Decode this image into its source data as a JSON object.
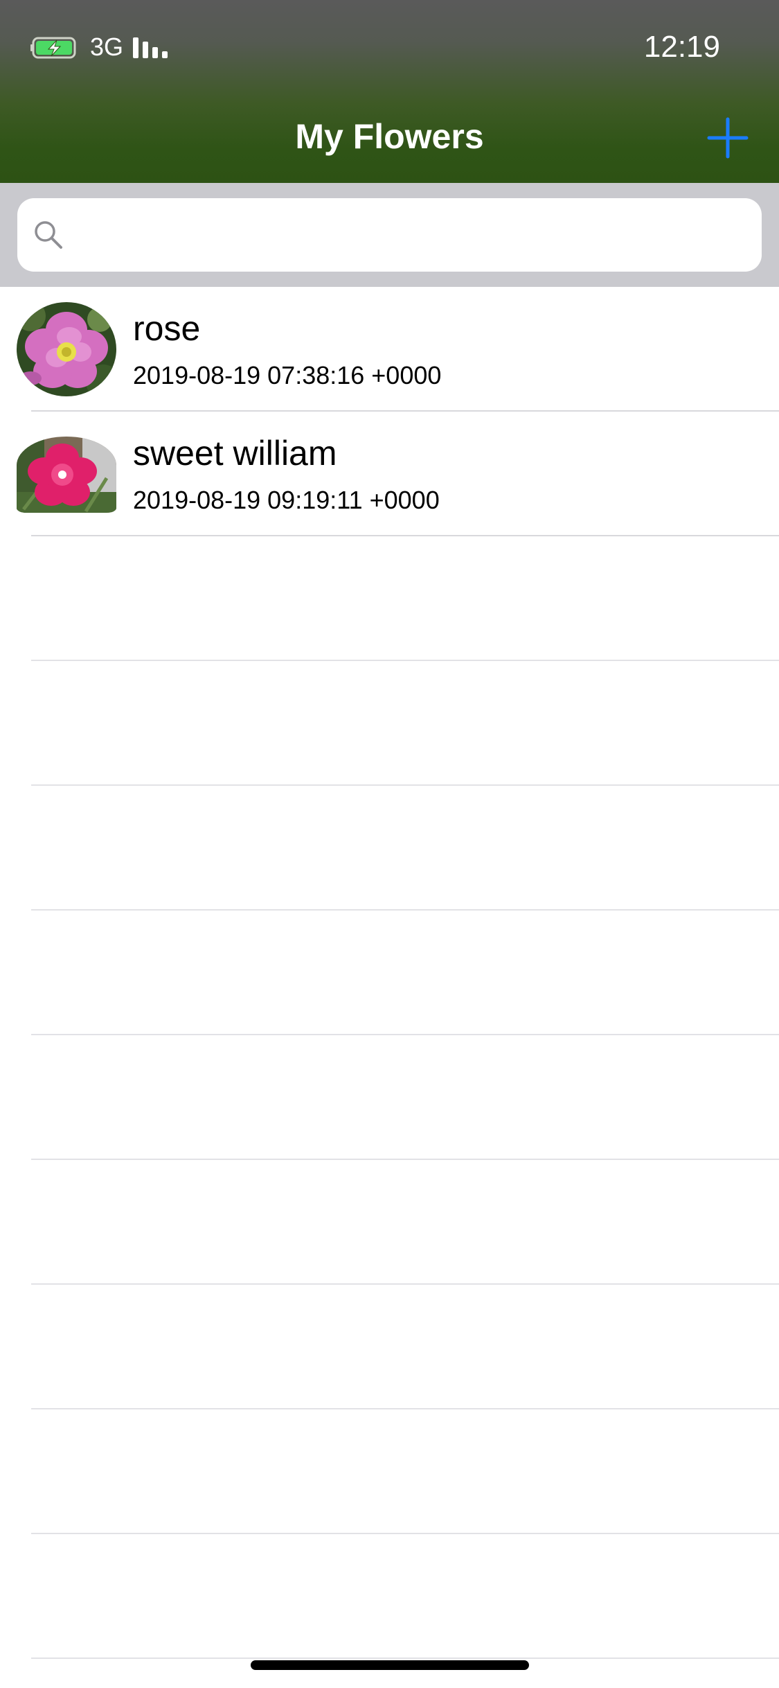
{
  "status_bar": {
    "network": "3G",
    "time": "12:19",
    "battery_icon": "battery-charging-icon",
    "signal_icon": "signal-bars-icon"
  },
  "nav": {
    "title": "My Flowers",
    "add_icon": "plus-icon",
    "accent_color": "#1a7cff"
  },
  "search": {
    "placeholder": "",
    "value": "",
    "icon": "search-icon"
  },
  "flowers": [
    {
      "name": "rose",
      "date": "2019-08-19 07:38:16 +0000"
    },
    {
      "name": "sweet william",
      "date": "2019-08-19 09:19:11 +0000"
    }
  ],
  "colors": {
    "header_top": "#5a5a5a",
    "header_bottom": "#2d5214",
    "search_bar_bg": "#c9c9ce"
  }
}
